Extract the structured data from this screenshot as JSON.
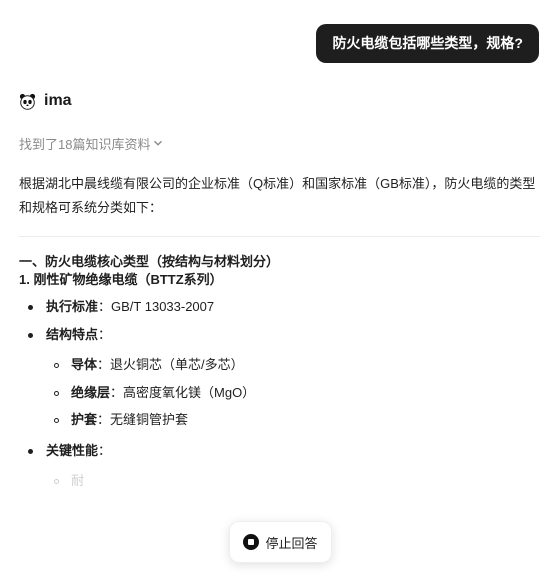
{
  "user_message": "防火电缆包括哪些类型，规格?",
  "bot": {
    "name": "ima",
    "avatar_icon": "panda-icon"
  },
  "kb_found": {
    "label": "找到了18篇知识库资料",
    "icon": "chevron-down-icon"
  },
  "answer": {
    "intro": "根据湖北中晨线缆有限公司的企业标准（Q标准）和国家标准（GB标准），防火电缆的类型和规格可系统分类如下：",
    "section_title": "一、防火电缆核心类型（按结构与材料划分）",
    "sub_title": "1. 刚性矿物绝缘电缆（BTTZ系列）",
    "items": [
      {
        "label": "执行标准",
        "value": "：GB/T 13033-2007"
      },
      {
        "label": "结构特点",
        "value": "："
      }
    ],
    "structure": [
      {
        "label": "导体",
        "value": "：退火铜芯（单芯/多芯）"
      },
      {
        "label": "绝缘层",
        "value": "：高密度氧化镁（MgO）"
      },
      {
        "label": "护套",
        "value": "：无缝铜管护套"
      }
    ],
    "key_label": "关键性能",
    "key_suffix": "：",
    "key_partial": "耐"
  },
  "stop_button": {
    "label": "停止回答",
    "icon": "stop-icon"
  }
}
